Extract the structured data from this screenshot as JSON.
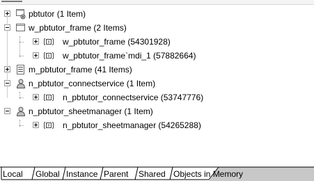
{
  "tree": {
    "nodes": [
      {
        "label": "pbtutor (1 Item)",
        "expander": "plus",
        "icon": "application-icon"
      },
      {
        "label": "w_pbtutor_frame (2 Items)",
        "expander": "minus",
        "icon": "window-icon"
      },
      {
        "label": "w_pbtutor_frame (54301928)",
        "expander": "plus",
        "icon": "instance-icon"
      },
      {
        "label": "w_pbtutor_frame`mdi_1 (57882664)",
        "expander": "plus",
        "icon": "instance-icon"
      },
      {
        "label": "m_pbtutor_frame (41 Items)",
        "expander": "plus",
        "icon": "menu-icon"
      },
      {
        "label": "n_pbtutor_connectservice (1 Item)",
        "expander": "minus",
        "icon": "user-object-icon"
      },
      {
        "label": "n_pbtutor_connectservice (53747776)",
        "expander": "plus",
        "icon": "instance-icon"
      },
      {
        "label": "n_pbtutor_sheetmanager (1 Item)",
        "expander": "minus",
        "icon": "user-object-icon"
      },
      {
        "label": "n_pbtutor_sheetmanager (54265288)",
        "expander": "plus",
        "icon": "instance-icon"
      }
    ]
  },
  "tabs": [
    "Local",
    "Global",
    "Instance",
    "Parent",
    "Shared",
    "Objects in Memory"
  ],
  "active_tab": "Objects in Memory"
}
